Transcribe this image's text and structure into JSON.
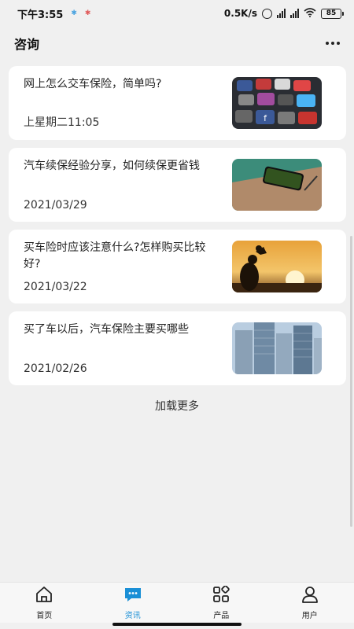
{
  "status_bar": {
    "time": "下午3:55",
    "network_speed": "0.5K/s",
    "battery": "85",
    "icons": [
      "app-notification-icon",
      "app-notification-icon-2",
      "alarm-icon",
      "signal-icon",
      "wifi-icon",
      "battery-icon"
    ]
  },
  "header": {
    "title": "咨询",
    "more_icon": "more-dots-icon"
  },
  "articles": [
    {
      "title": "网上怎么交车保险，简单吗?",
      "date": "上星期二11:05",
      "image": "social-media-apps"
    },
    {
      "title": "汽车续保经验分享，如何续保更省钱",
      "date": "2021/03/29",
      "image": "phone-on-desk"
    },
    {
      "title": "买车险时应该注意什么?怎样购买比较好?",
      "date": "2021/03/22",
      "image": "sunset-silhouette"
    },
    {
      "title": "买了车以后，汽车保险主要买哪些",
      "date": "2021/02/26",
      "image": "skyscrapers"
    }
  ],
  "load_more": "加载更多",
  "tabs": [
    {
      "label": "首页",
      "icon": "home-icon",
      "active": false
    },
    {
      "label": "资讯",
      "icon": "chat-icon",
      "active": true
    },
    {
      "label": "产品",
      "icon": "grid-icon",
      "active": false
    },
    {
      "label": "用户",
      "icon": "user-icon",
      "active": false
    }
  ],
  "colors": {
    "accent": "#1a8fd6",
    "background": "#f0f0f0",
    "card": "#ffffff"
  }
}
